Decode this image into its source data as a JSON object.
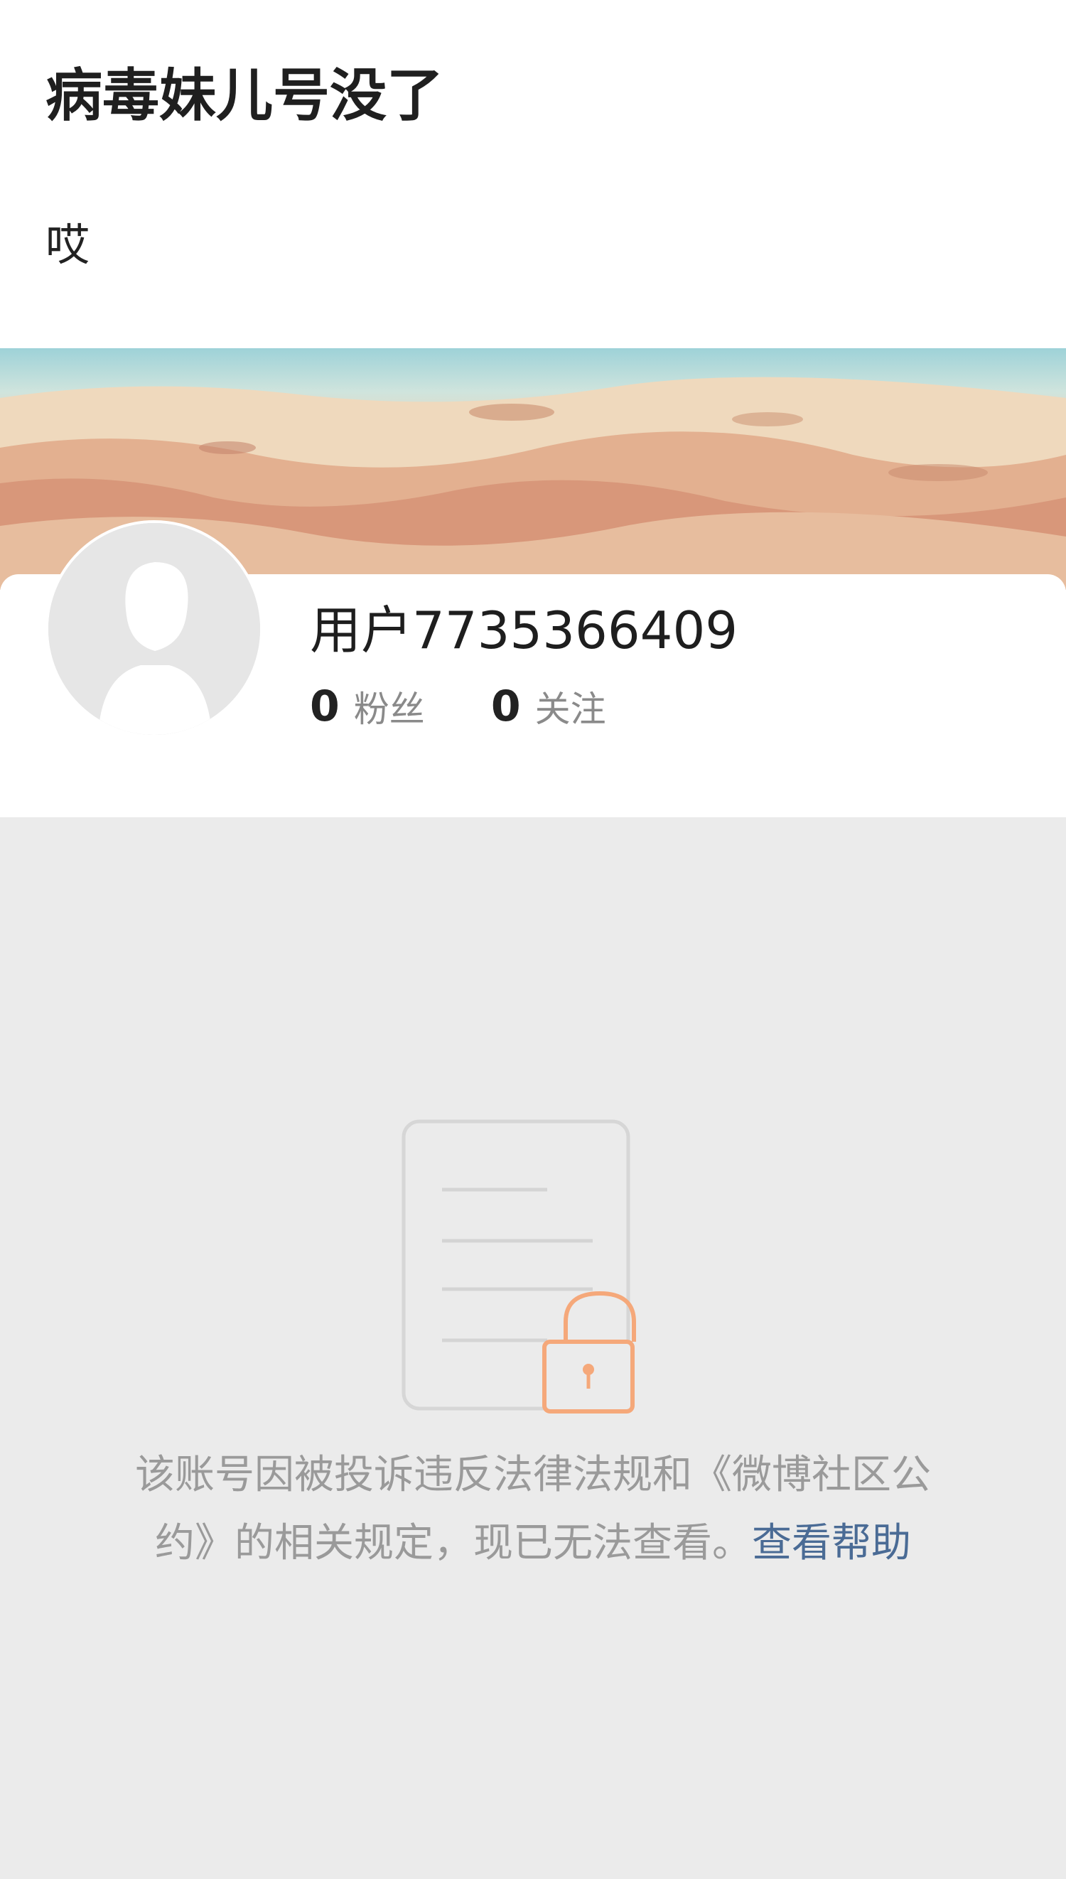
{
  "post": {
    "title": "病毒妹儿号没了",
    "body": "哎"
  },
  "profile": {
    "username": "用户7735366409",
    "followers_count": "0",
    "followers_label": "粉丝",
    "following_count": "0",
    "following_label": "关注"
  },
  "notice": {
    "text": "该账号因被投诉违反法律法规和《微博社区公约》的相关规定，现已无法查看。",
    "help_link": "查看帮助"
  },
  "colors": {
    "lock_accent": "#f5a87a",
    "link": "#4a6b95",
    "background_gray": "#ebebeb"
  },
  "icons": {
    "avatar": "default-avatar-silhouette",
    "illustration": "document-lock-icon"
  }
}
